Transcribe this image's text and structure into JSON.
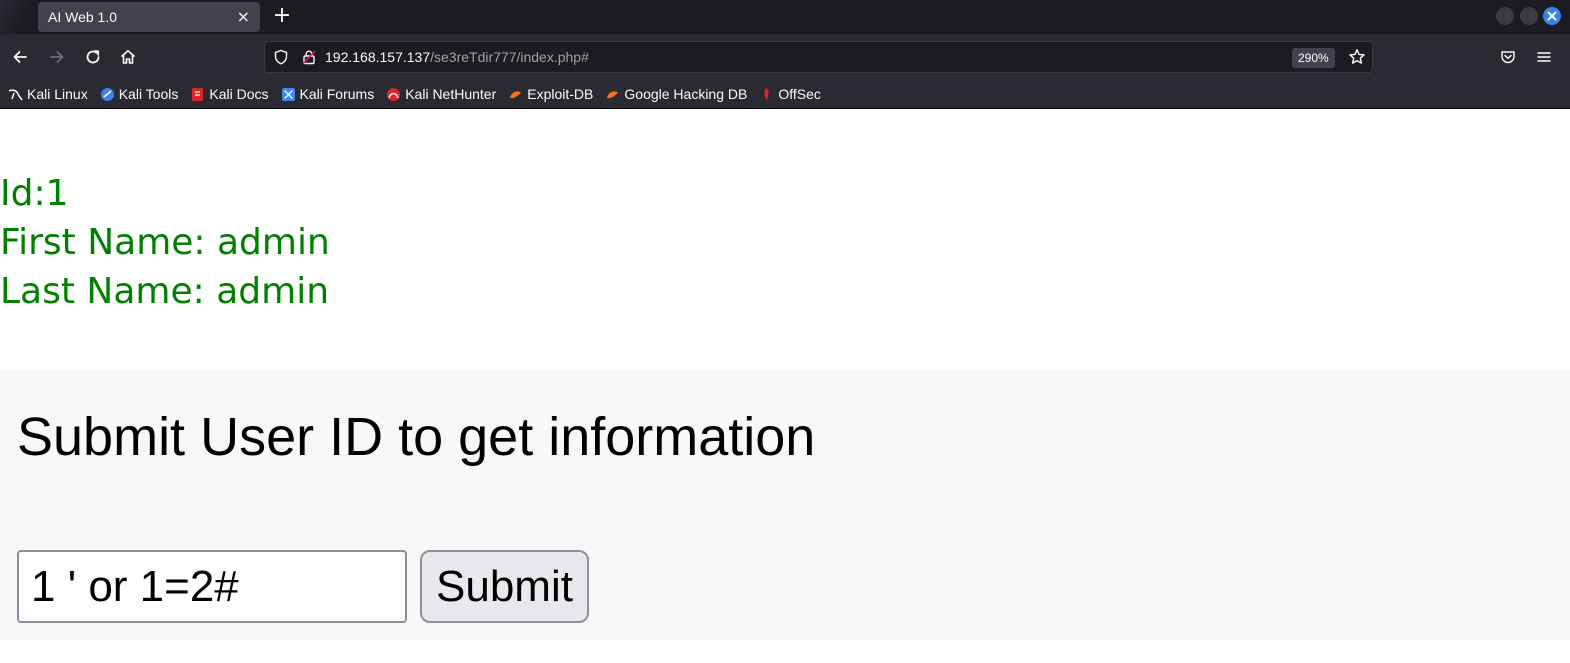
{
  "browser": {
    "tab": {
      "title": "AI Web 1.0",
      "close_glyph": "×"
    },
    "new_tab_glyph": "+",
    "url": {
      "host": "192.168.157.137",
      "path": "/se3reTdir777/index.php#"
    },
    "zoom": "290%",
    "bookmarks": [
      {
        "label": "Kali Linux",
        "icon": "kali-dragon-icon",
        "color": "#ffffff"
      },
      {
        "label": "Kali Tools",
        "icon": "kali-tools-icon",
        "color": "#3b82f6"
      },
      {
        "label": "Kali Docs",
        "icon": "kali-docs-icon",
        "color": "#dc2626"
      },
      {
        "label": "Kali Forums",
        "icon": "kali-forums-icon",
        "color": "#3b82f6"
      },
      {
        "label": "Kali NetHunter",
        "icon": "kali-nethunter-icon",
        "color": "#dc2626"
      },
      {
        "label": "Exploit-DB",
        "icon": "exploit-db-icon",
        "color": "#f97316"
      },
      {
        "label": "Google Hacking DB",
        "icon": "ghdb-icon",
        "color": "#f97316"
      },
      {
        "label": "OffSec",
        "icon": "offsec-icon",
        "color": "#dc2626"
      }
    ]
  },
  "result": {
    "id_line": "Id:1",
    "first_name_line": "First Name: admin",
    "last_name_line": "Last Name: admin",
    "color": "#008000"
  },
  "form": {
    "heading": "Submit User ID to get information",
    "input_value": "1 ' or 1=2#",
    "submit_label": "Submit"
  }
}
